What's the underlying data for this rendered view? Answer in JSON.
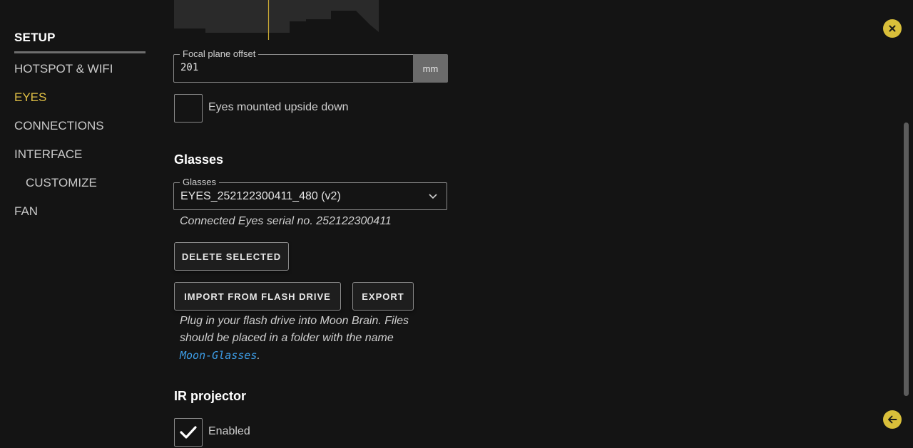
{
  "sidebar": {
    "title": "SETUP",
    "items": [
      {
        "label": "HOTSPOT & WIFI"
      },
      {
        "label": "EYES"
      },
      {
        "label": "CONNECTIONS"
      },
      {
        "label": "INTERFACE"
      },
      {
        "label": "CUSTOMIZE"
      },
      {
        "label": "FAN"
      }
    ],
    "active_item": "EYES"
  },
  "focal_plane": {
    "label": "Focal plane offset",
    "value": "201",
    "unit": "mm"
  },
  "eyes_upside_down": {
    "label": "Eyes mounted upside down",
    "checked": false
  },
  "glasses_section": {
    "title": "Glasses",
    "select_label": "Glasses",
    "selected_value": "EYES_252122300411_480 (v2)",
    "serial_note": "Connected Eyes serial no. 252122300411",
    "delete_button": "DELETE SELECTED",
    "import_button": "IMPORT FROM FLASH DRIVE",
    "export_button": "EXPORT",
    "help_text_1": "Plug in your flash drive into Moon Brain. Files",
    "help_text_2": "should be placed in a folder with the name",
    "folder_name": "Moon-Glasses",
    "help_text_end": "."
  },
  "ir_projector": {
    "title": "IR projector",
    "label": "Enabled",
    "checked": true
  },
  "icons": {
    "close": "close-icon",
    "back": "arrow-left-icon",
    "chevron": "chevron-down-icon",
    "check": "check-icon"
  },
  "colors": {
    "accent": "#d9bf3a",
    "active_nav": "#e0c045",
    "link": "#3d9ee8",
    "background": "#141414"
  }
}
